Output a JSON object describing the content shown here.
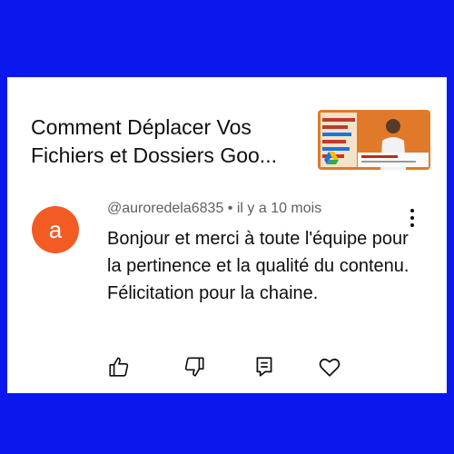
{
  "video": {
    "title": "Comment Déplacer Vos Fichiers et Dossiers Goo..."
  },
  "comment": {
    "avatar_letter": "a",
    "author": "@auroredela6835",
    "separator": " • ",
    "time": "il y a 10 mois",
    "text": "Bonjour et merci à toute l'équipe pour la pertinence et la qualité du contenu. Félicitation pour la chaine."
  },
  "colors": {
    "background": "#0a18ee",
    "avatar": "#f35b24"
  },
  "icons": [
    "thumbs-up-icon",
    "thumbs-down-icon",
    "reply-icon",
    "heart-icon",
    "more-vertical-icon"
  ]
}
